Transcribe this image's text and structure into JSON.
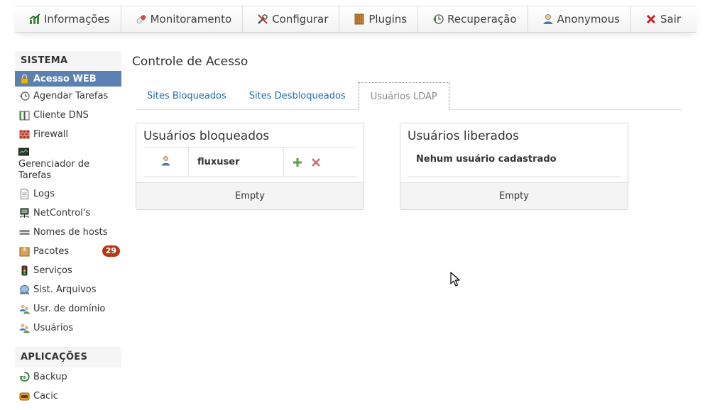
{
  "topnav": {
    "items": [
      {
        "label": "Informações",
        "icon": "chart-up-icon"
      },
      {
        "label": "Monitoramento",
        "icon": "pill-icon"
      },
      {
        "label": "Configurar",
        "icon": "tools-icon"
      },
      {
        "label": "Plugins",
        "icon": "book-icon"
      },
      {
        "label": "Recuperação",
        "icon": "restore-icon"
      },
      {
        "label": "Anonymous",
        "icon": "user-icon"
      },
      {
        "label": "Sair",
        "icon": "close-icon"
      }
    ]
  },
  "sidebar": {
    "section1": "SISTEMA",
    "items": [
      {
        "label": "Acesso WEB",
        "icon": "lock-icon",
        "active": true
      },
      {
        "label": "Agendar Tarefas",
        "icon": "clock-back-icon"
      },
      {
        "label": "Cliente DNS",
        "icon": "book-open-icon"
      },
      {
        "label": "Firewall",
        "icon": "brick-wall-icon"
      },
      {
        "label": "Gerenciador de Tarefas",
        "icon": "monitor-icon"
      },
      {
        "label": "Logs",
        "icon": "document-icon"
      },
      {
        "label": "NetControl's",
        "icon": "network-icon"
      },
      {
        "label": "Nomes de hosts",
        "icon": "rack-icon"
      },
      {
        "label": "Pacotes",
        "icon": "package-icon",
        "badge": "29"
      },
      {
        "label": "Serviços",
        "icon": "traffic-light-icon"
      },
      {
        "label": "Sist. Arquivos",
        "icon": "hard-disk-icon"
      },
      {
        "label": "Usr. de domínio",
        "icon": "users-icon"
      },
      {
        "label": "Usuários",
        "icon": "users-icon"
      }
    ],
    "section2": "APLICAÇÕES",
    "apps": [
      {
        "label": "Backup",
        "icon": "backup-icon"
      },
      {
        "label": "Cacic",
        "icon": "cacic-icon"
      }
    ]
  },
  "main": {
    "title": "Controle de Acesso",
    "tabs": [
      {
        "label": "Sites Bloqueados"
      },
      {
        "label": "Sites Desbloqueados"
      },
      {
        "label": "Usuários LDAP",
        "active": true
      }
    ],
    "blocked": {
      "title": "Usuários bloqueados",
      "users": [
        {
          "name": "fluxuser"
        }
      ],
      "footer": "Empty"
    },
    "allowed": {
      "title": "Usuários liberados",
      "empty_text": "Nehum usuário cadastrado",
      "footer": "Empty"
    }
  },
  "colors": {
    "accent": "#5b80b2",
    "link": "#1f6ca8",
    "badge": "#b53a14"
  }
}
